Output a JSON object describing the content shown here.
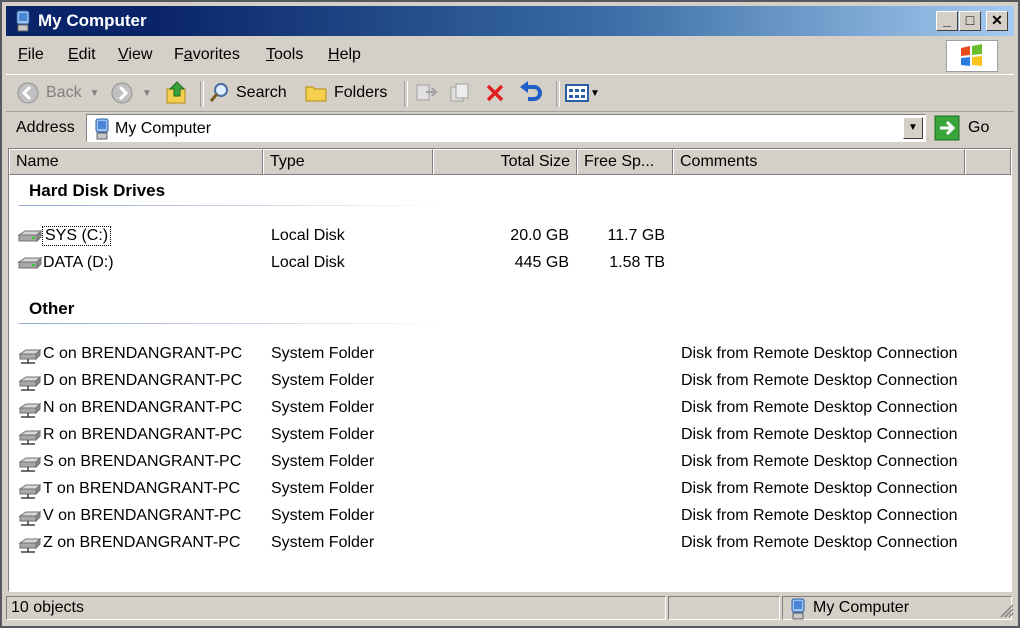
{
  "window": {
    "title": "My Computer"
  },
  "menu": [
    {
      "label": "File",
      "underline": "F",
      "rest": "ile"
    },
    {
      "label": "Edit",
      "underline": "E",
      "rest": "dit"
    },
    {
      "label": "View",
      "underline": "V",
      "rest": "iew"
    },
    {
      "label": "Favorites",
      "underline": "a",
      "pre": "F",
      "rest": "vorites"
    },
    {
      "label": "Tools",
      "underline": "T",
      "rest": "ools"
    },
    {
      "label": "Help",
      "underline": "H",
      "rest": "elp"
    }
  ],
  "toolbar": {
    "back_label": "Back",
    "search_label": "Search",
    "folders_label": "Folders"
  },
  "address": {
    "label": "Address",
    "value": "My Computer",
    "go_label": "Go"
  },
  "columns": [
    "Name",
    "Type",
    "Total Size",
    "Free Sp...",
    "Comments"
  ],
  "groups": {
    "hard_disk": "Hard Disk Drives",
    "other": "Other"
  },
  "drives": [
    {
      "name": "SYS (C:)",
      "type": "Local Disk",
      "total": "20.0 GB",
      "free": "11.7 GB"
    },
    {
      "name": "DATA (D:)",
      "type": "Local Disk",
      "total": "445 GB",
      "free": "1.58 TB"
    }
  ],
  "remote": [
    {
      "name": "C on BRENDANGRANT-PC",
      "type": "System Folder",
      "comment": "Disk from Remote Desktop Connection"
    },
    {
      "name": "D on BRENDANGRANT-PC",
      "type": "System Folder",
      "comment": "Disk from Remote Desktop Connection"
    },
    {
      "name": "N on BRENDANGRANT-PC",
      "type": "System Folder",
      "comment": "Disk from Remote Desktop Connection"
    },
    {
      "name": "R on BRENDANGRANT-PC",
      "type": "System Folder",
      "comment": "Disk from Remote Desktop Connection"
    },
    {
      "name": "S on BRENDANGRANT-PC",
      "type": "System Folder",
      "comment": "Disk from Remote Desktop Connection"
    },
    {
      "name": "T on BRENDANGRANT-PC",
      "type": "System Folder",
      "comment": "Disk from Remote Desktop Connection"
    },
    {
      "name": "V on BRENDANGRANT-PC",
      "type": "System Folder",
      "comment": "Disk from Remote Desktop Connection"
    },
    {
      "name": "Z on BRENDANGRANT-PC",
      "type": "System Folder",
      "comment": "Disk from Remote Desktop Connection"
    }
  ],
  "status": {
    "count": "10 objects",
    "location": "My Computer"
  },
  "colors": {
    "title_start": "#0a246a",
    "title_end": "#a6caf0",
    "chrome": "#d4d0c8"
  }
}
